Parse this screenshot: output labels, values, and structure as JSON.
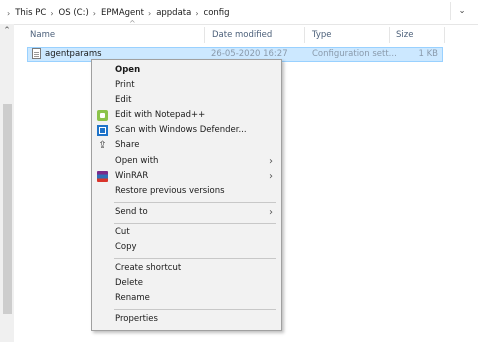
{
  "breadcrumb": [
    "This PC",
    "OS (C:)",
    "EPMAgent",
    "appdata",
    "config"
  ],
  "columns": {
    "name": "Name",
    "date": "Date modified",
    "type": "Type",
    "size": "Size"
  },
  "file_row": {
    "name": "agentparams",
    "date": "26-05-2020 16:27",
    "type": "Configuration sett...",
    "size": "1 KB"
  },
  "context_menu": {
    "open": "Open",
    "print": "Print",
    "edit": "Edit",
    "edit_notepadpp": "Edit with Notepad++",
    "scan_defender": "Scan with Windows Defender...",
    "share": "Share",
    "open_with": "Open with",
    "winrar": "WinRAR",
    "restore": "Restore previous versions",
    "send_to": "Send to",
    "cut": "Cut",
    "copy": "Copy",
    "create_shortcut": "Create shortcut",
    "delete": "Delete",
    "rename": "Rename",
    "properties": "Properties"
  },
  "icons": {
    "notepadpp": "notepadpp-icon",
    "defender": "defender-icon",
    "share": "share-icon",
    "winrar": "winrar-icon",
    "submenu": "chevron-right-icon",
    "file": "config-file-icon"
  },
  "colors": {
    "selection_bg": "#cce8ff",
    "selection_border": "#99d1ff",
    "menu_bg": "#f2f2f2",
    "header_text": "#4c607a"
  }
}
